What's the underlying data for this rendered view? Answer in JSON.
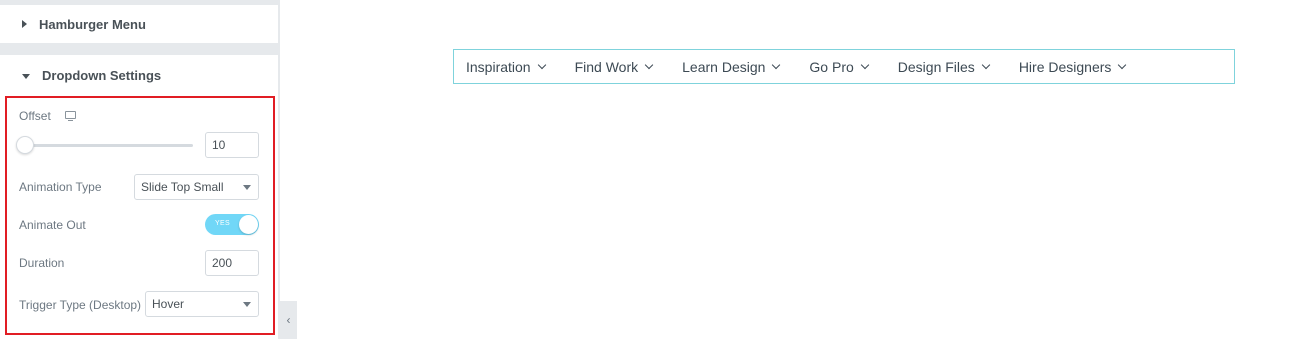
{
  "panel": {
    "sections": {
      "hamburger": {
        "title": "Hamburger Menu"
      },
      "dropdown": {
        "title": "Dropdown Settings"
      }
    },
    "offset": {
      "label": "Offset",
      "value": "10",
      "slider_fraction": 0.0
    },
    "animation_type": {
      "label": "Animation Type",
      "value": "Slide Top Small"
    },
    "animate_out": {
      "label": "Animate Out",
      "toggle_text": "YES",
      "enabled": true
    },
    "duration": {
      "label": "Duration",
      "value": "200"
    },
    "trigger_type": {
      "label": "Trigger Type (Desktop)",
      "value": "Hover"
    },
    "collapse_glyph": "‹"
  },
  "nav": {
    "items": [
      {
        "label": "Inspiration"
      },
      {
        "label": "Find Work"
      },
      {
        "label": "Learn Design"
      },
      {
        "label": "Go Pro"
      },
      {
        "label": "Design Files"
      },
      {
        "label": "Hire Designers"
      }
    ]
  },
  "colors": {
    "highlight": "#e11d24",
    "toggle_on": "#71d7f7",
    "nav_border": "#7fd3dc"
  }
}
